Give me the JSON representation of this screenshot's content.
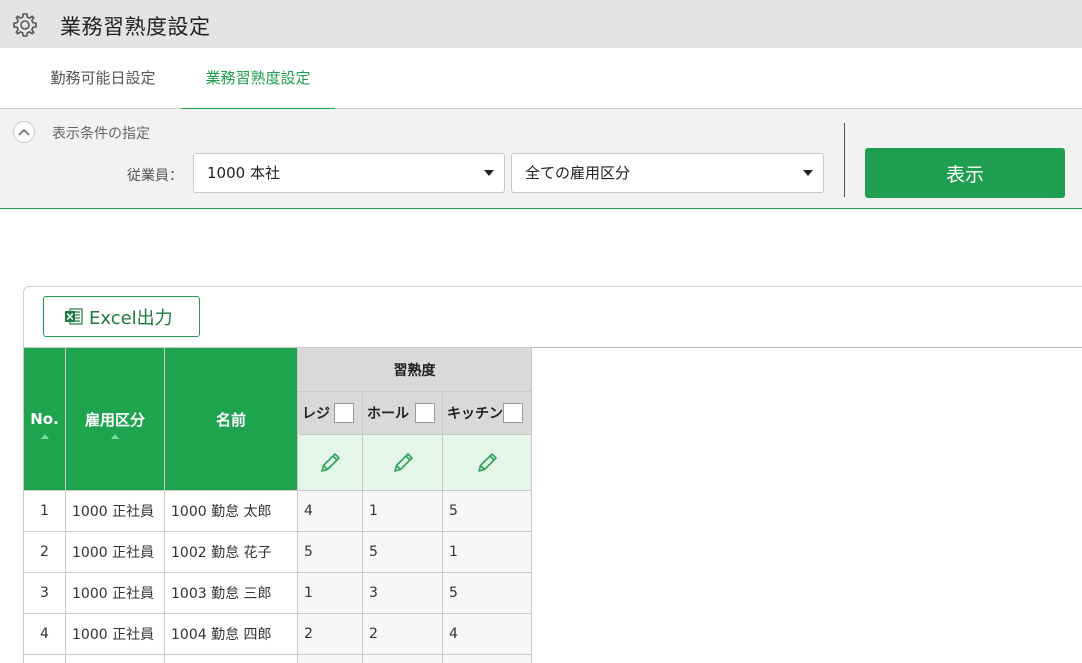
{
  "header": {
    "title": "業務習熟度設定",
    "icon": "gear-icon"
  },
  "tabs": [
    {
      "label": "勤務可能日設定",
      "active": false
    },
    {
      "label": "業務習熟度設定",
      "active": true
    }
  ],
  "conditions": {
    "section_label": "表示条件の指定",
    "employee_label": "従業員：",
    "employee_select": "1000 本社",
    "employment_select": "全ての雇用区分",
    "show_button": "表示"
  },
  "toolbar": {
    "excel_label": "Excel出力"
  },
  "table": {
    "headers": {
      "no": "No.",
      "type": "雇用区分",
      "name": "名前",
      "skill": "習熟度"
    },
    "skills": [
      "レジ",
      "ホール",
      "キッチン"
    ],
    "rows": [
      {
        "no": "1",
        "type": "1000 正社員",
        "name": "1000 勤怠 太郎",
        "values": [
          "4",
          "1",
          "5"
        ]
      },
      {
        "no": "2",
        "type": "1000 正社員",
        "name": "1002 勤怠 花子",
        "values": [
          "5",
          "5",
          "1"
        ]
      },
      {
        "no": "3",
        "type": "1000 正社員",
        "name": "1003 勤怠 三郎",
        "values": [
          "1",
          "3",
          "5"
        ]
      },
      {
        "no": "4",
        "type": "1000 正社員",
        "name": "1004 勤怠 四郎",
        "values": [
          "2",
          "2",
          "4"
        ]
      }
    ]
  },
  "colors": {
    "accent": "#1e9e4e",
    "header_bg": "#e4e4e4"
  }
}
